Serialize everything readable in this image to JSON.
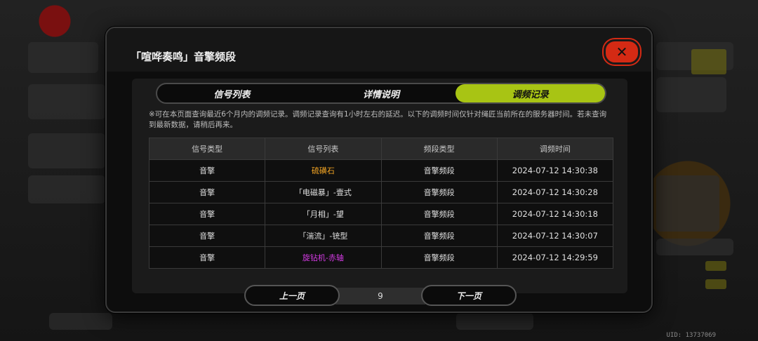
{
  "modal": {
    "title": "「喧哗奏鸣」音擎频段",
    "close_icon": "close-x-icon"
  },
  "tabs": [
    {
      "label": "信号列表",
      "active": false
    },
    {
      "label": "详情说明",
      "active": false
    },
    {
      "label": "调频记录",
      "active": true
    }
  ],
  "notice": "※可在本页面查询最近6个月内的调频记录。调频记录查询有1小时左右的延迟。以下的调频时间仅针对绳匠当前所在的服务器时间。若未查询到最新数据，请稍后再来。",
  "table": {
    "headers": [
      "信号类型",
      "信号列表",
      "频段类型",
      "调频时间"
    ],
    "rows": [
      {
        "type": "音擎",
        "item": "硫磺石",
        "item_color": "#f5a623",
        "band": "音擎频段",
        "time": "2024-07-12 14:30:38"
      },
      {
        "type": "音擎",
        "item": "「电磁暴」-壹式",
        "item_color": "#e0e0e0",
        "band": "音擎频段",
        "time": "2024-07-12 14:30:28"
      },
      {
        "type": "音擎",
        "item": "「月相」-望",
        "item_color": "#e0e0e0",
        "band": "音擎频段",
        "time": "2024-07-12 14:30:18"
      },
      {
        "type": "音擎",
        "item": "「湍流」-铳型",
        "item_color": "#e0e0e0",
        "band": "音擎频段",
        "time": "2024-07-12 14:30:07"
      },
      {
        "type": "音擎",
        "item": "旋钻机-赤轴",
        "item_color": "#d63be6",
        "band": "音擎频段",
        "time": "2024-07-12 14:29:59"
      }
    ]
  },
  "pager": {
    "prev_label": "上一页",
    "page": "9",
    "next_label": "下一页"
  },
  "uid": "UID: 13737069",
  "colors": {
    "accent": "#a8c414",
    "close": "#d42a14"
  }
}
